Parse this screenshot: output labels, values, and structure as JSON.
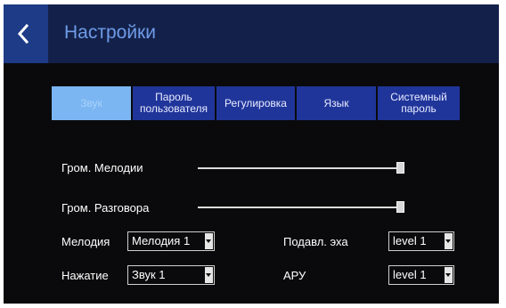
{
  "header": {
    "title": "Настройки",
    "back_icon": "chevron-left-icon"
  },
  "tabs": [
    {
      "label": "Звук",
      "active": true
    },
    {
      "label": "Пароль пользователя",
      "active": false
    },
    {
      "label": "Регулировка",
      "active": false
    },
    {
      "label": "Язык",
      "active": false
    },
    {
      "label": "Системный пароль",
      "active": false
    }
  ],
  "volume": {
    "melody_label": "Гром. Мелодии",
    "melody_level": 1.0,
    "talk_label": "Гром. Разговора",
    "talk_level": 1.0
  },
  "settings": {
    "melody_label": "Мелодия",
    "melody_value": "Мелодия 1",
    "press_label": "Нажатие",
    "press_value": "Звук 1",
    "echo_label": "Подавл. эха",
    "echo_value": "level 1",
    "agc_label": "АРУ",
    "agc_value": "level 1"
  },
  "colors": {
    "header_bg": "#13214a",
    "tab_bg": "#20359a",
    "tab_active_bg": "#7bb6f2",
    "title": "#6f9be8"
  }
}
